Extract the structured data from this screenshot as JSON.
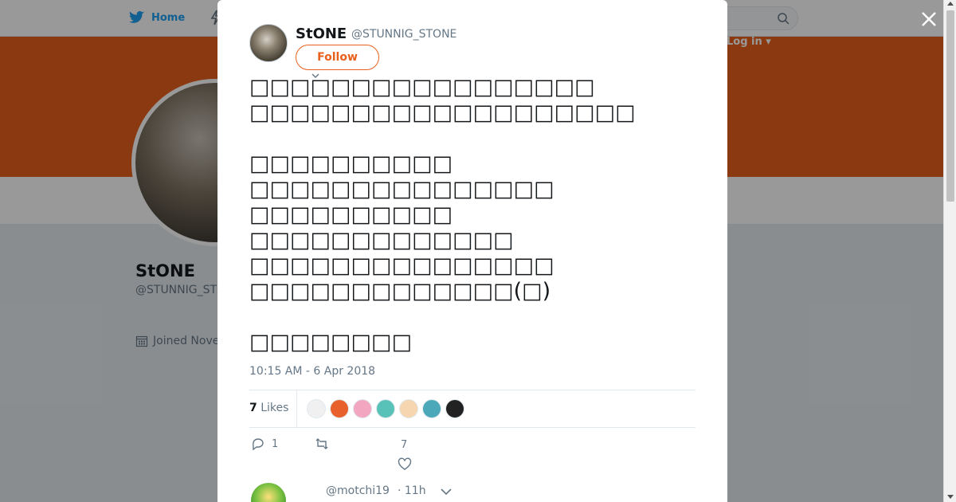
{
  "nav": {
    "home_label": "Home",
    "login_label": "Log in ▾"
  },
  "profile": {
    "name": "StONE",
    "handle": "@STUNNIG_STONE",
    "joined": "Joined Nove"
  },
  "tweet": {
    "name": "StONE",
    "handle": "@STUNNIG_STONE",
    "follow_label": "Follow",
    "text": "□□□□□□□□□□□□□□□□□\n□□□□□□□□□□□□□□□□□□□\n\n□□□□□□□□□□\n□□□□□□□□□□□□□□□\n□□□□□□□□□□\n□□□□□□□□□□□□□\n□□□□□□□□□□□□□□□\n□□□□□□□□□□□□□(□)\n\n□□□□□□□□",
    "date": "10:15 AM - 6 Apr 2018",
    "likes_count": "7",
    "likes_label": "Likes",
    "reply_count": "1",
    "like_count": "7"
  },
  "likers": [
    {
      "name": "liker-1",
      "color": "#f0f0f0"
    },
    {
      "name": "liker-2",
      "color": "#e8602c"
    },
    {
      "name": "liker-3",
      "color": "#f2a6c0"
    },
    {
      "name": "liker-4",
      "color": "#58c2b8"
    },
    {
      "name": "liker-5",
      "color": "#f5d6b0"
    },
    {
      "name": "liker-6",
      "color": "#4aa8b8"
    },
    {
      "name": "liker-7",
      "color": "#222222"
    }
  ],
  "reply": {
    "handle": "@motchi19",
    "time": "· 11h"
  },
  "colors": {
    "accent": "#e8601c",
    "twitter_blue": "#1da1f2"
  }
}
